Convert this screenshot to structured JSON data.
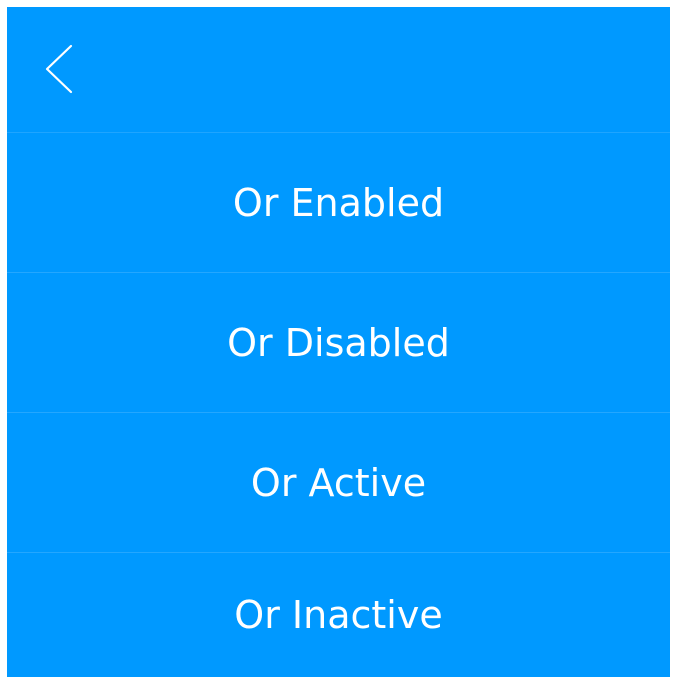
{
  "header": {
    "back_icon": "chevron-left-icon"
  },
  "menu": {
    "items": [
      {
        "label": "Or Enabled"
      },
      {
        "label": "Or Disabled"
      },
      {
        "label": "Or Active"
      },
      {
        "label": "Or Inactive"
      }
    ]
  },
  "colors": {
    "background": "#0099ff",
    "text": "#ffffff"
  }
}
